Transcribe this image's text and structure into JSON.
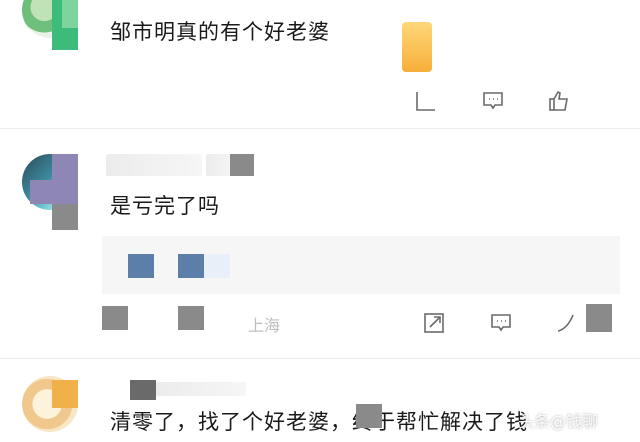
{
  "comments": [
    {
      "text": "邹市明真的有个好老婆",
      "avatar_icon": "avatar-icon",
      "actions": [
        "share-icon",
        "comment-icon",
        "like-icon"
      ]
    },
    {
      "text": "是亏完了吗",
      "avatar_icon": "avatar-icon",
      "location": "上海",
      "actions": [
        "share-icon",
        "comment-icon",
        "like-icon"
      ]
    },
    {
      "text": "清零了，找了个好老婆，终于帮忙解决了钱",
      "avatar_icon": "avatar-icon"
    }
  ],
  "watermark": "头条@钱聊",
  "colors": {
    "background": "#ffffff",
    "text": "#1a1a1a",
    "icon": "#6a6a6a",
    "divider": "#ececec",
    "quote_bg": "#f6f6f6",
    "mosaic_green": "#3dbb7a",
    "mosaic_blue": "#5b7fa8",
    "mosaic_gray": "#8a8a8a",
    "mosaic_purple": "#8e86b5",
    "mosaic_orange": "#f0b04a"
  }
}
